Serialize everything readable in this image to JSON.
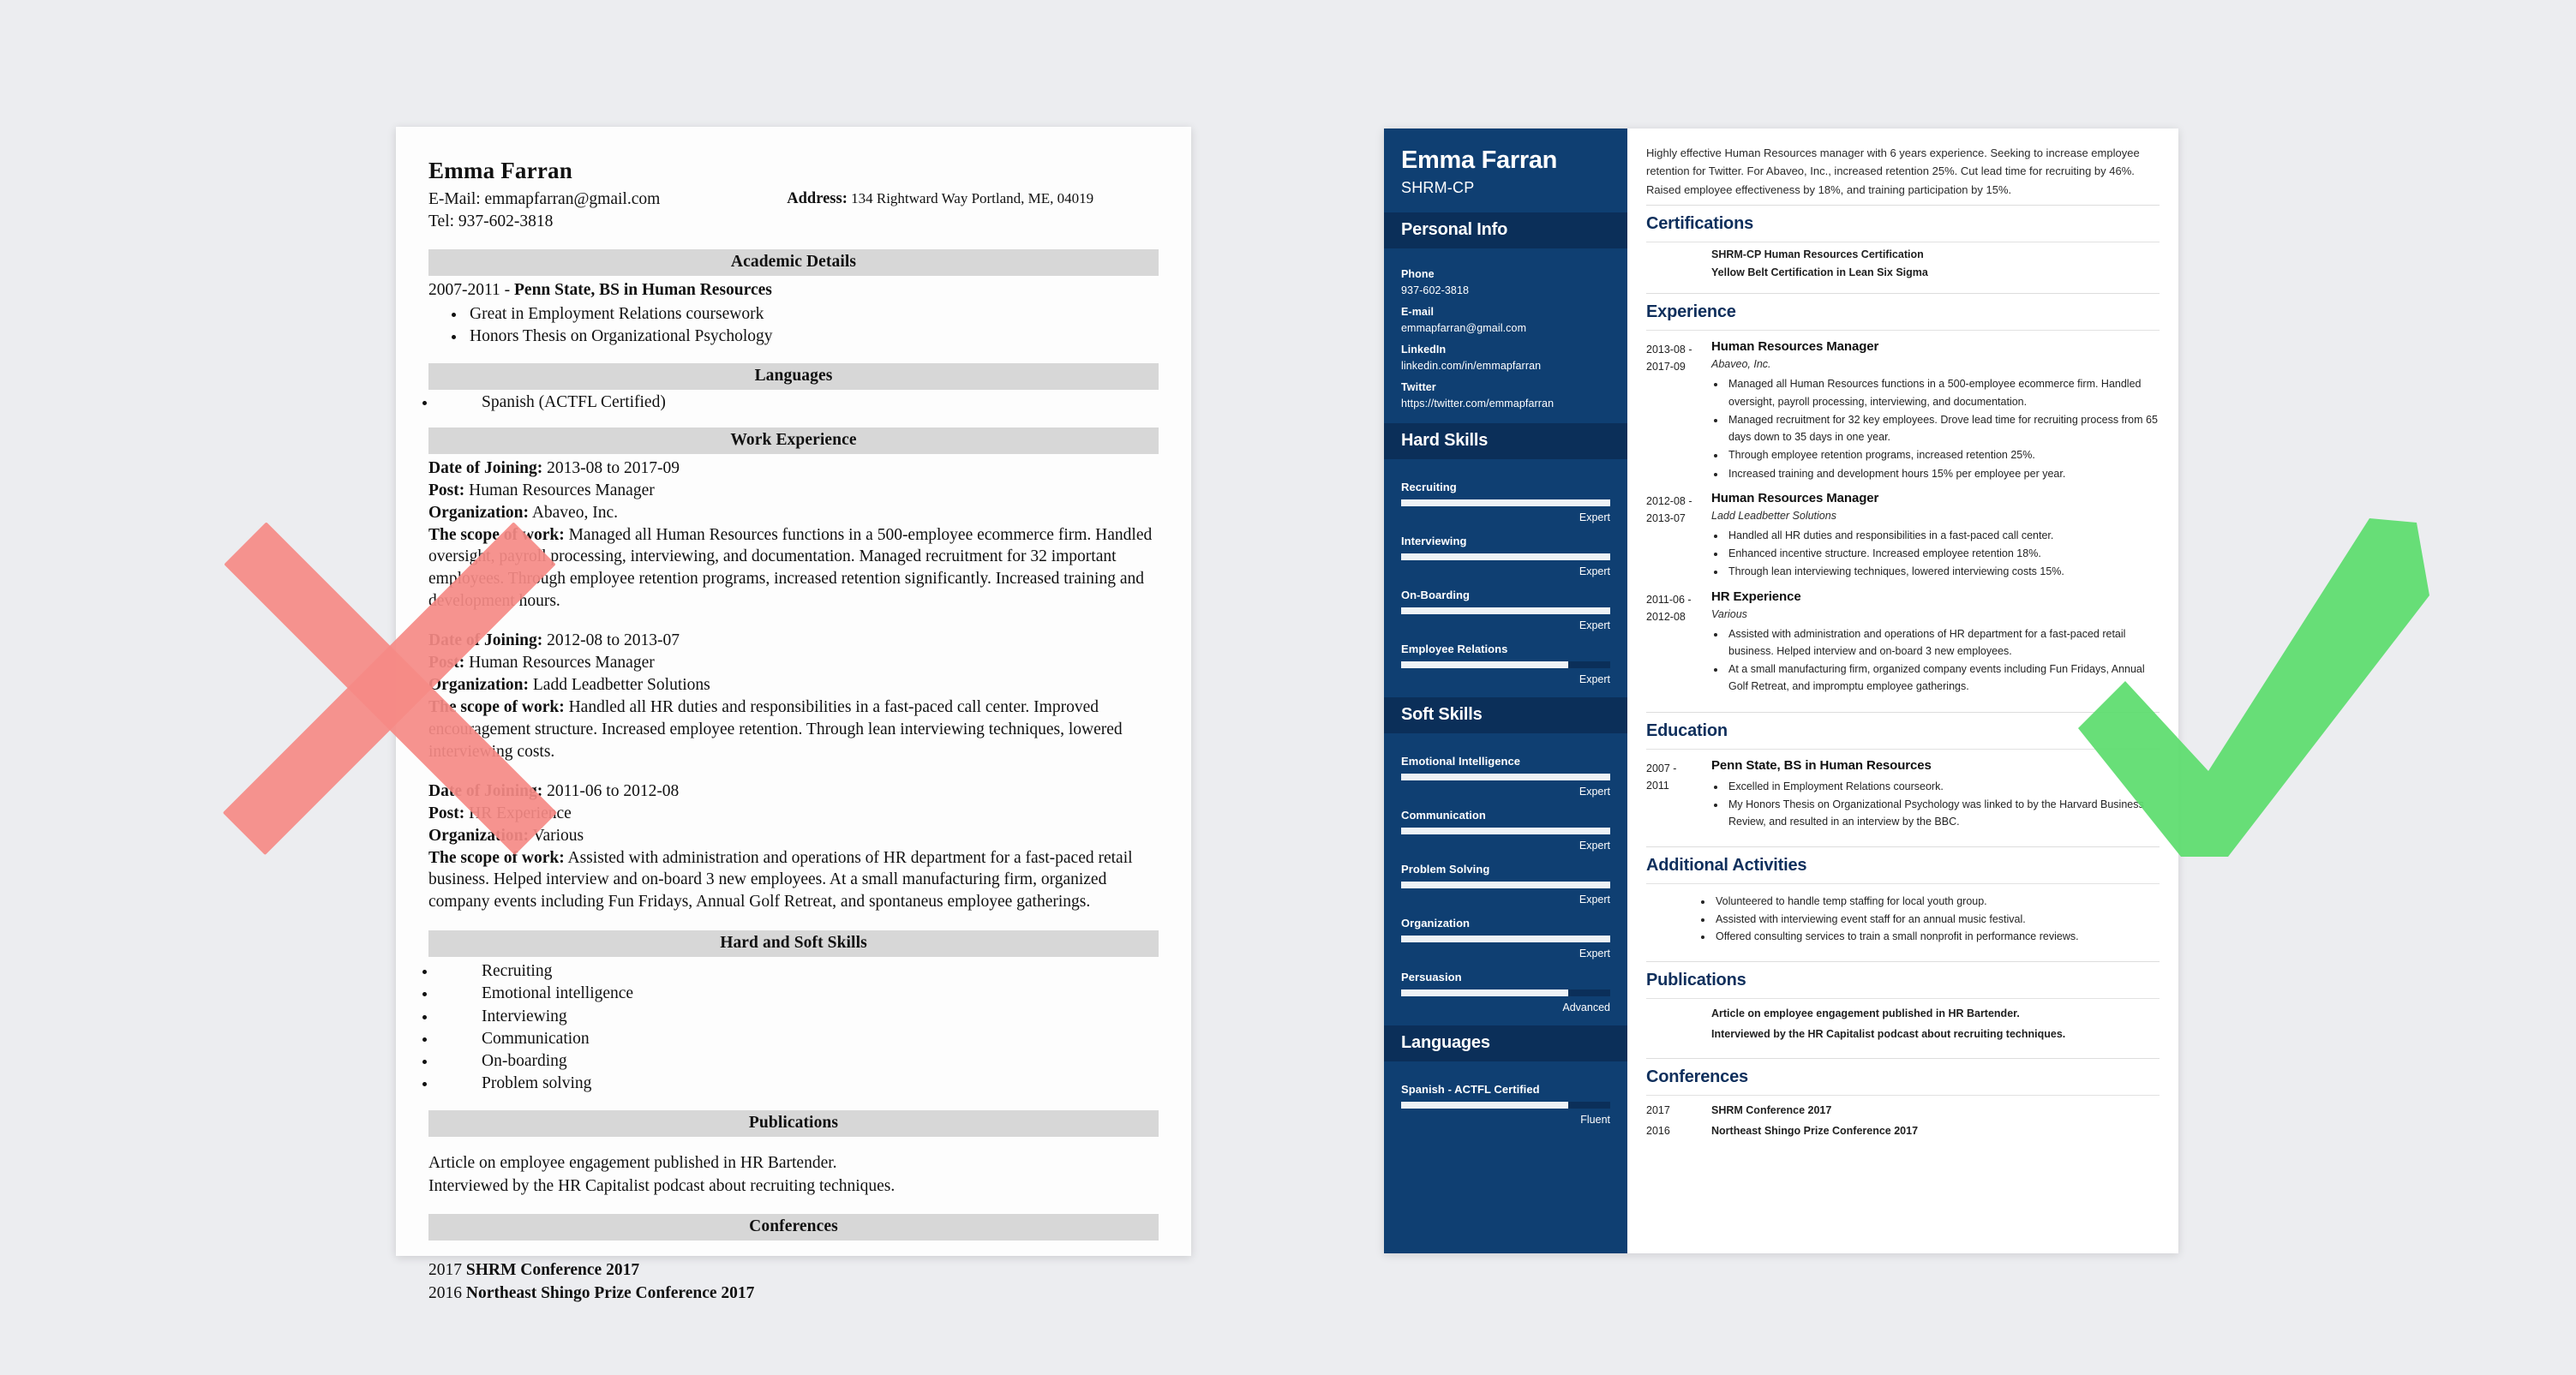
{
  "colors": {
    "page_background": "#ecedf0",
    "sidebar_blue": "#0f3f72",
    "sidebar_band_blue": "#0b2f59",
    "heading_blue": "#0f2f5c",
    "bad_band_gray": "#d7d7d7",
    "reject_mark": "#F58A85",
    "accept_mark": "#5CDD6E"
  },
  "marks": {
    "reject": {
      "icon": "x-mark-icon",
      "meaning": "bad resume example"
    },
    "accept": {
      "icon": "check-mark-icon",
      "meaning": "good resume example"
    }
  },
  "bad_resume": {
    "name": "Emma Farran",
    "email_line": "E-Mail: emmapfarran@gmail.com",
    "tel_line": "Tel: 937-602-3818",
    "address_label": "Address:",
    "address_value": "134 Rightward Way Portland, ME, 04019",
    "sections": {
      "academic": {
        "heading": "Academic Details",
        "degree_line": "2007-2011 - ",
        "degree_bold": "Penn State, BS in Human Resources",
        "bullets": [
          "Great in Employment Relations coursework",
          "Honors Thesis on Organizational Psychology"
        ]
      },
      "languages": {
        "heading": "Languages",
        "items": [
          "Spanish (ACTFL Certified)"
        ]
      },
      "work": {
        "heading": "Work Experience",
        "labels": {
          "date": "Date of Joining:",
          "post": "Post:",
          "org": "Organization:",
          "scope": "The scope of work:"
        },
        "jobs": [
          {
            "date": "2013-08 to 2017-09",
            "post": "Human Resources Manager",
            "org": "Abaveo, Inc.",
            "scope": "Managed all Human Resources functions in a 500-employee ecommerce firm. Handled oversight, payroll processing, interviewing, and documentation. Managed recruitment for 32 important employees. Through employee retention programs, increased retention significantly. Increased training and development hours."
          },
          {
            "date": "2012-08 to 2013-07",
            "post": "Human Resources Manager",
            "org": "Ladd Leadbetter Solutions",
            "scope": "Handled all HR duties and responsibilities in a fast-paced call center. Improved encouragement structure. Increased employee retention. Through lean interviewing techniques, lowered interviewing costs."
          },
          {
            "date": "2011-06 to 2012-08",
            "post": "HR Experience",
            "org": "Various",
            "scope": "Assisted with administration and operations of HR department for a fast-paced retail business. Helped interview and on-board 3 new employees. At a small manufacturing firm, organized company events including Fun Fridays, Annual Golf Retreat, and spontaneus employee gatherings."
          }
        ]
      },
      "skills": {
        "heading": "Hard and Soft Skills",
        "items": [
          "Recruiting",
          "Emotional intelligence",
          "Interviewing",
          "Communication",
          "On-boarding",
          "Problem solving"
        ]
      },
      "publications": {
        "heading": "Publications",
        "lines": [
          "Article on employee engagement published in HR Bartender.",
          "Interviewed by the HR Capitalist podcast about recruiting techniques."
        ]
      },
      "conferences": {
        "heading": "Conferences",
        "items": [
          {
            "year": "2017",
            "name": "SHRM Conference 2017"
          },
          {
            "year": "2016",
            "name": "Northeast Shingo Prize Conference 2017"
          }
        ]
      }
    }
  },
  "good_resume": {
    "sidebar": {
      "name": "Emma Farran",
      "subtitle": "SHRM-CP",
      "personal_info": {
        "heading": "Personal Info",
        "fields": [
          {
            "label": "Phone",
            "value": "937-602-3818"
          },
          {
            "label": "E-mail",
            "value": "emmapfarran@gmail.com"
          },
          {
            "label": "LinkedIn",
            "value": "linkedin.com/in/emmapfarran"
          },
          {
            "label": "Twitter",
            "value": "https://twitter.com/emmapfarran"
          }
        ]
      },
      "hard_skills": {
        "heading": "Hard Skills",
        "items": [
          {
            "name": "Recruiting",
            "level": "Expert",
            "percent": 100
          },
          {
            "name": "Interviewing",
            "level": "Expert",
            "percent": 100
          },
          {
            "name": "On-Boarding",
            "level": "Expert",
            "percent": 100
          },
          {
            "name": "Employee Relations",
            "level": "Expert",
            "percent": 80
          }
        ]
      },
      "soft_skills": {
        "heading": "Soft Skills",
        "items": [
          {
            "name": "Emotional Intelligence",
            "level": "Expert",
            "percent": 100
          },
          {
            "name": "Communication",
            "level": "Expert",
            "percent": 100
          },
          {
            "name": "Problem Solving",
            "level": "Expert",
            "percent": 100
          },
          {
            "name": "Organization",
            "level": "Expert",
            "percent": 100
          },
          {
            "name": "Persuasion",
            "level": "Advanced",
            "percent": 80
          }
        ]
      },
      "languages": {
        "heading": "Languages",
        "items": [
          {
            "name": "Spanish - ACTFL Certified",
            "level": "Fluent",
            "percent": 80
          }
        ]
      }
    },
    "main": {
      "summary": "Highly effective Human Resources manager with 6 years experience. Seeking to increase employee retention for Twitter. For Abaveo, Inc., increased retention 25%. Cut lead time for recruiting by 46%. Raised employee effectiveness by 18%, and training participation by 15%.",
      "certifications": {
        "heading": "Certifications",
        "items": [
          "SHRM-CP Human Resources Certification",
          "Yellow Belt Certification in Lean Six Sigma"
        ]
      },
      "experience": {
        "heading": "Experience",
        "entries": [
          {
            "date_from": "2013-08 -",
            "date_to": "2017-09",
            "title": "Human Resources Manager",
            "org": "Abaveo, Inc.",
            "bullets": [
              "Managed all Human Resources functions in a 500-employee ecommerce firm. Handled oversight, payroll processing, interviewing, and documentation.",
              "Managed recruitment for 32 key employees. Drove lead time for recruiting process from 65 days down to 35 days in one year.",
              "Through employee retention programs, increased retention 25%.",
              "Increased training and development hours 15% per employee per year."
            ]
          },
          {
            "date_from": "2012-08 -",
            "date_to": "2013-07",
            "title": "Human Resources Manager",
            "org": "Ladd Leadbetter Solutions",
            "bullets": [
              "Handled all HR duties and responsibilities in a fast-paced call center.",
              "Enhanced incentive structure. Increased employee retention 18%.",
              "Through lean interviewing techniques, lowered interviewing costs 15%."
            ]
          },
          {
            "date_from": "2011-06 -",
            "date_to": "2012-08",
            "title": "HR Experience",
            "org": "Various",
            "bullets": [
              "Assisted with administration and operations of HR department for a fast-paced retail business. Helped interview and on-board 3 new employees.",
              "At a small manufacturing firm, organized company events including Fun Fridays, Annual Golf Retreat, and impromptu employee gatherings."
            ]
          }
        ]
      },
      "education": {
        "heading": "Education",
        "entries": [
          {
            "date_from": "2007 -",
            "date_to": "2011",
            "title": "Penn State, BS in Human Resources",
            "bullets": [
              "Excelled in Employment Relations courseork.",
              "My Honors Thesis on Organizational Psychology was linked to by the Harvard Business Review, and resulted in an interview by the BBC."
            ]
          }
        ]
      },
      "additional_activities": {
        "heading": "Additional Activities",
        "bullets": [
          "Volunteered to handle temp staffing for local youth group.",
          "Assisted with interviewing event staff for an annual music festival.",
          "Offered consulting services to train a small nonprofit in performance reviews."
        ]
      },
      "publications": {
        "heading": "Publications",
        "items": [
          "Article on employee engagement published in HR Bartender.",
          "Interviewed by the HR Capitalist podcast about recruiting techniques."
        ]
      },
      "conferences": {
        "heading": "Conferences",
        "items": [
          {
            "year": "2017",
            "name": "SHRM Conference 2017"
          },
          {
            "year": "2016",
            "name": "Northeast Shingo Prize Conference 2017"
          }
        ]
      }
    }
  }
}
